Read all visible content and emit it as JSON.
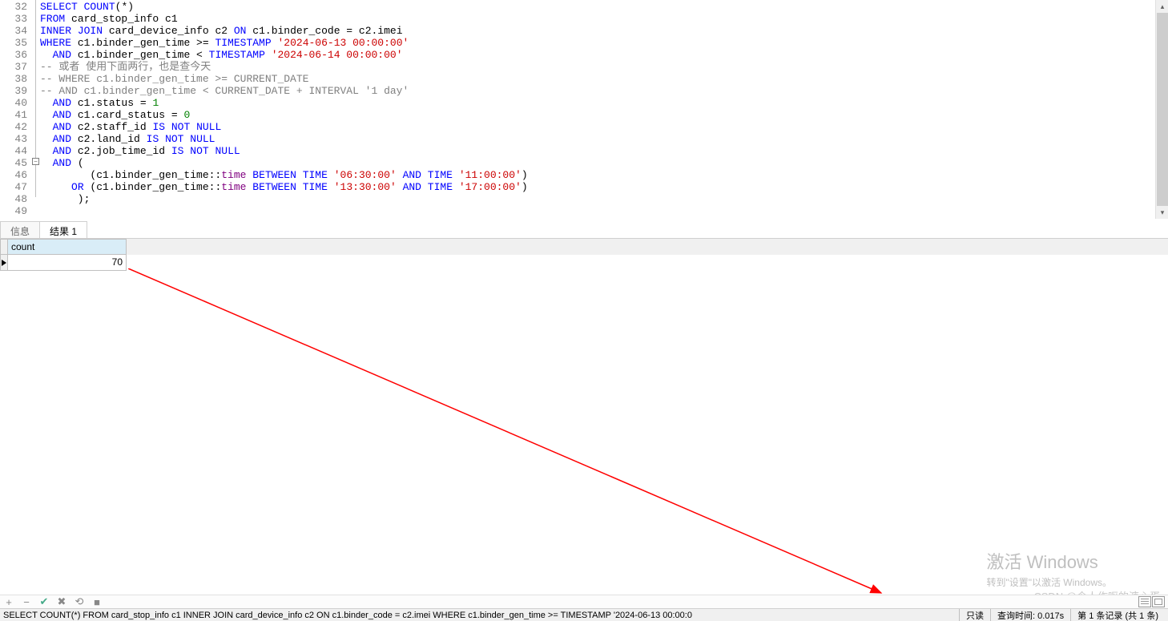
{
  "editor": {
    "lines": [
      {
        "n": 32,
        "html": "<span class='kw'>SELECT</span> <span class='kw'>COUNT</span>(*)"
      },
      {
        "n": 33,
        "html": "<span class='kw'>FROM</span> card_stop_info c1"
      },
      {
        "n": 34,
        "html": "<span class='kw'>INNER</span> <span class='kw'>JOIN</span> card_device_info c2 <span class='kw'>ON</span> c1.binder_code = c2.imei"
      },
      {
        "n": 35,
        "html": "<span class='kw'>WHERE</span> c1.binder_gen_time &gt;= <span class='kw'>TIMESTAMP</span> <span class='str'>'2024-06-13 00:00:00'</span>"
      },
      {
        "n": 36,
        "html": "  <span class='kw'>AND</span> c1.binder_gen_time &lt; <span class='kw'>TIMESTAMP</span> <span class='str'>'2024-06-14 00:00:00'</span>"
      },
      {
        "n": 37,
        "html": "<span class='cmt'>-- 或者 使用下面两行，也是查今天</span>"
      },
      {
        "n": 38,
        "html": "<span class='cmt'>-- WHERE c1.binder_gen_time &gt;= CURRENT_DATE</span>"
      },
      {
        "n": 39,
        "html": "<span class='cmt'>-- AND c1.binder_gen_time &lt; CURRENT_DATE + INTERVAL '1 day'</span>"
      },
      {
        "n": 40,
        "html": "  <span class='kw'>AND</span> c1.status = <span class='num'>1</span>"
      },
      {
        "n": 41,
        "html": "  <span class='kw'>AND</span> c1.card_status = <span class='num'>0</span>"
      },
      {
        "n": 42,
        "html": "  <span class='kw'>AND</span> c2.staff_id <span class='kw'>IS</span> <span class='kw'>NOT</span> <span class='kw'>NULL</span>"
      },
      {
        "n": 43,
        "html": "  <span class='kw'>AND</span> c2.land_id <span class='kw'>IS</span> <span class='kw'>NOT</span> <span class='kw'>NULL</span>"
      },
      {
        "n": 44,
        "html": "  <span class='kw'>AND</span> c2.job_time_id <span class='kw'>IS</span> <span class='kw'>NOT</span> <span class='kw'>NULL</span>"
      },
      {
        "n": 45,
        "html": "  <span class='kw'>AND</span> ("
      },
      {
        "n": 46,
        "html": "        (c1.binder_gen_time::<span class='cast'>time</span> <span class='kw'>BETWEEN</span> <span class='kw'>TIME</span> <span class='str'>'06:30:00'</span> <span class='kw'>AND</span> <span class='kw'>TIME</span> <span class='str'>'11:00:00'</span>)"
      },
      {
        "n": 47,
        "html": "     <span class='kw'>OR</span> (c1.binder_gen_time::<span class='cast'>time</span> <span class='kw'>BETWEEN</span> <span class='kw'>TIME</span> <span class='str'>'13:30:00'</span> <span class='kw'>AND</span> <span class='kw'>TIME</span> <span class='str'>'17:00:00'</span>)"
      },
      {
        "n": 48,
        "html": "      );"
      },
      {
        "n": 49,
        "html": ""
      }
    ]
  },
  "tabs": {
    "info": "信息",
    "result": "结果 1"
  },
  "grid": {
    "columns": [
      "count"
    ],
    "rows": [
      [
        "70"
      ]
    ]
  },
  "toolbar": {
    "add": "+",
    "del": "−",
    "ok": "✔",
    "cancel": "✖",
    "refresh": "⟲",
    "stop": "■"
  },
  "status": {
    "query": "SELECT COUNT(*) FROM card_stop_info c1 INNER JOIN card_device_info c2 ON c1.binder_code = c2.imei WHERE c1.binder_gen_time >= TIMESTAMP '2024-06-13 00:00:0",
    "readonly": "只读",
    "time": "查询时间: 0.017s",
    "rec": "第 1 条记录 (共 1 条)"
  },
  "watermark": {
    "title": "激活 Windows",
    "sub": "转到\"设置\"以激活 Windows。"
  },
  "csdn": "CSDN @令人作呕的溏心蛋"
}
